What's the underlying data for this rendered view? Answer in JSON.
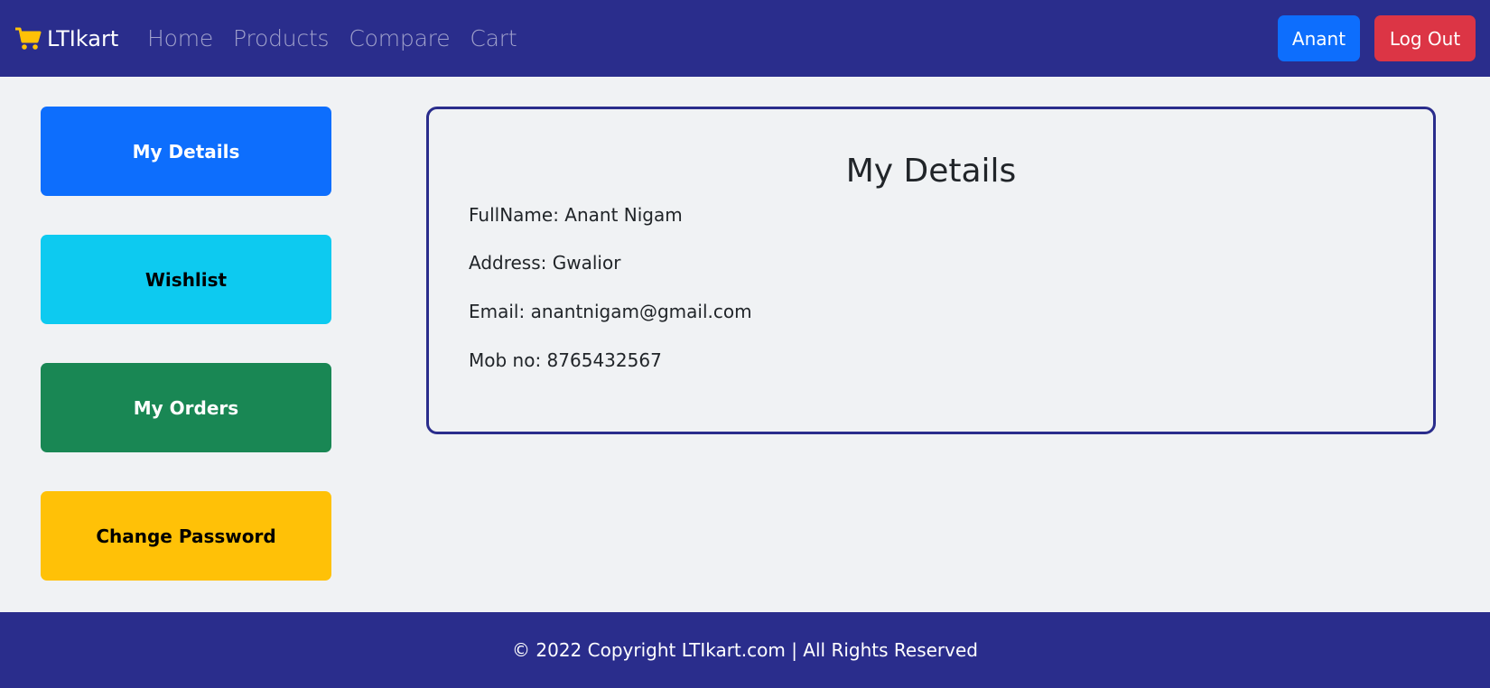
{
  "navbar": {
    "brand": "LTIkart",
    "brand_icon": "cart-icon",
    "links": [
      "Home",
      "Products",
      "Compare",
      "Cart"
    ],
    "user_button": "Anant",
    "logout_button": "Log Out"
  },
  "sidebar": {
    "items": [
      "My Details",
      "Wishlist",
      "My Orders",
      "Change Password"
    ]
  },
  "details": {
    "title": "My Details",
    "fullname": "FullName: Anant Nigam",
    "address": "Address: Gwalior",
    "email": "Email: anantnigam@gmail.com",
    "mobile": "Mob no: 8765432567"
  },
  "footer": {
    "text": "© 2022 Copyright LTIkart.com | All Rights Reserved"
  },
  "colors": {
    "navbar": "#2a2d8c",
    "primary": "#0d6efd",
    "danger": "#dc3545",
    "info": "#0dcaf0",
    "success": "#198754",
    "warning": "#ffc107",
    "brand_icon": "#ffc107"
  }
}
